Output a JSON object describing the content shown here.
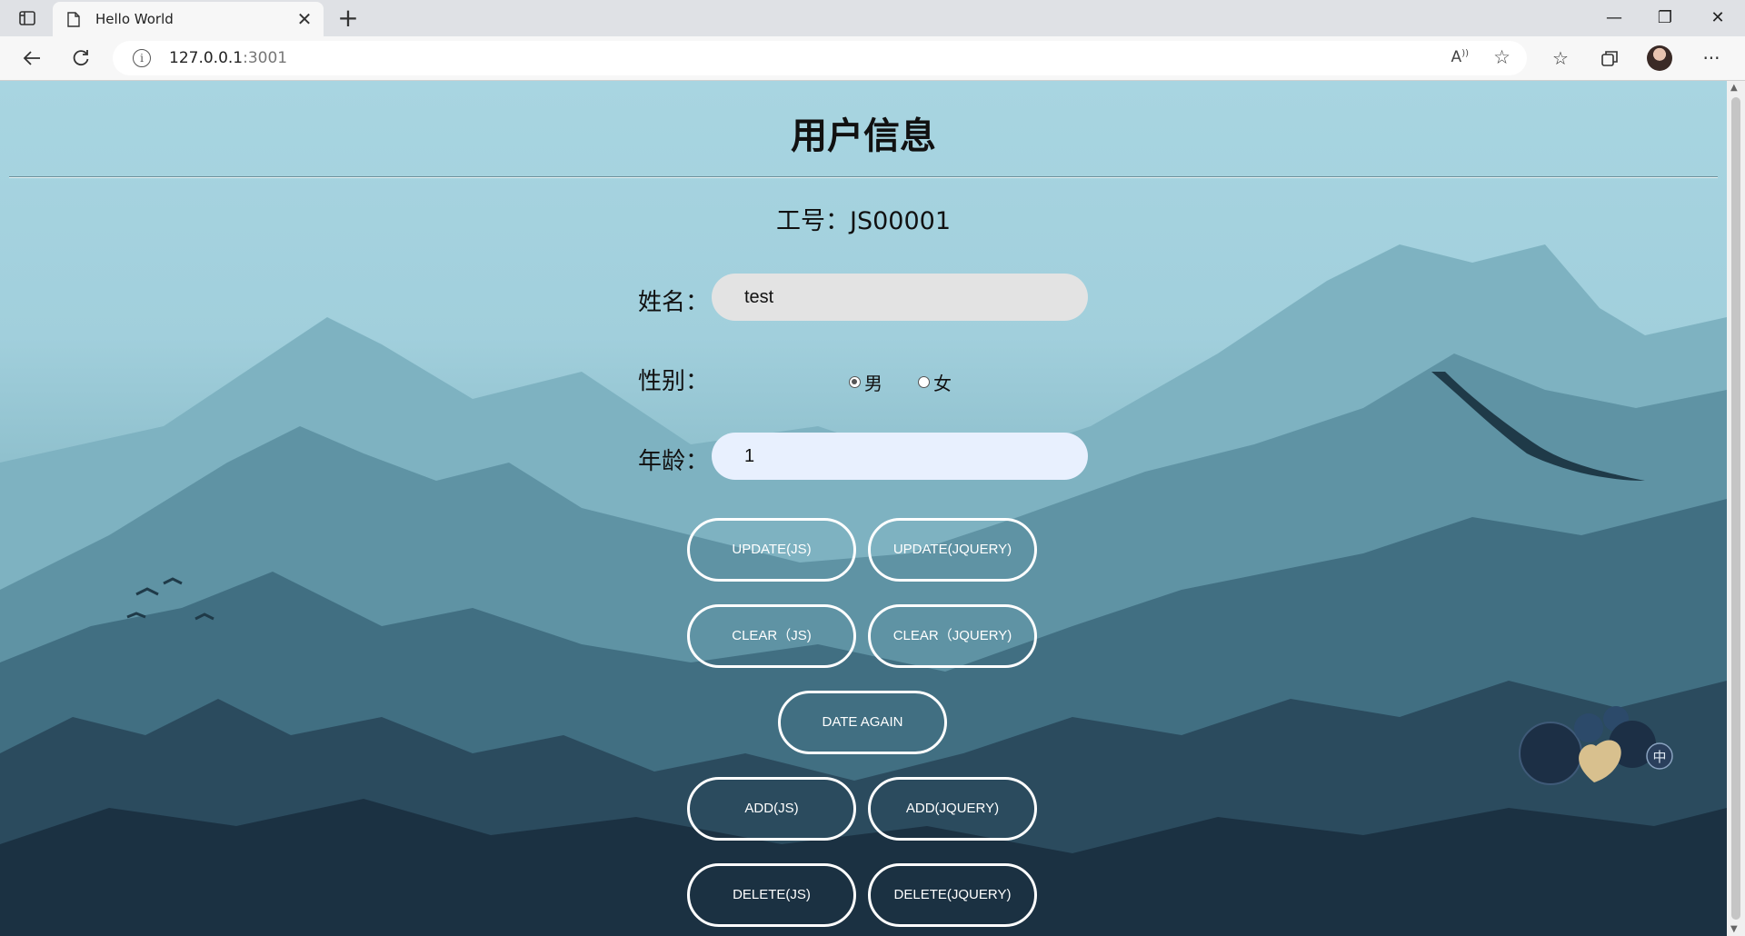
{
  "browser": {
    "tab_title": "Hello World",
    "new_tab": "+",
    "url_host": "127.0.0.1",
    "url_port": ":3001"
  },
  "page": {
    "heading": "用户信息",
    "employee_id": "工号：JS00001",
    "name_label": "姓名：",
    "name_value": "test",
    "gender_label": "性别：",
    "gender_options": [
      "男",
      "女"
    ],
    "gender_selected": "男",
    "age_label": "年龄：",
    "age_value": "1",
    "buttons": {
      "update_js": "UPDATE(JS)",
      "update_jquery": "UPDATE(JQUERY)",
      "clear_js": "CLEAR（JS)",
      "clear_jquery": "CLEAR（JQUERY)",
      "date_again": "DATE AGAIN",
      "add_js": "ADD(JS)",
      "add_jquery": "ADD(JQUERY)",
      "delete_js": "DELETE(JS)",
      "delete_jquery": "DELETE(JQUERY)"
    }
  },
  "colors": {
    "sky": "#a8d5e1",
    "name_field_bg": "#e3e3e3",
    "age_field_bg": "#e8f0fe",
    "button_border": "#ffffff"
  }
}
